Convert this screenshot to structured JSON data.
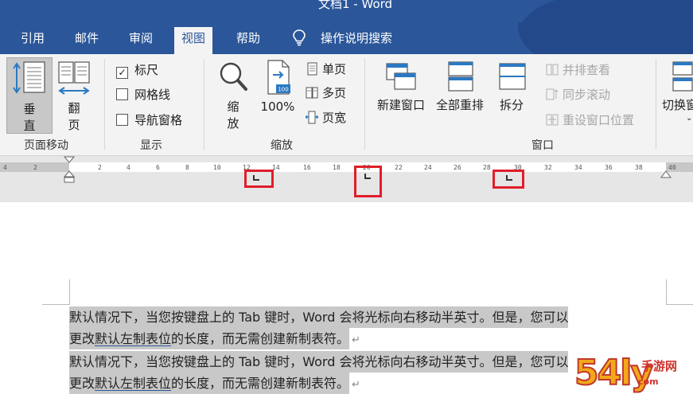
{
  "window": {
    "title": "文档1  -  Word"
  },
  "tabs": [
    {
      "label": "引用"
    },
    {
      "label": "邮件"
    },
    {
      "label": "审阅"
    },
    {
      "label": "视图",
      "active": true
    },
    {
      "label": "帮助"
    }
  ],
  "tell_me": {
    "label": "操作说明搜索",
    "icon": "lightbulb-icon"
  },
  "ribbon": {
    "page_movement": {
      "group_label": "页面移动",
      "vertical": {
        "line1": "垂",
        "line2": "直",
        "selected": true
      },
      "side_to_side": {
        "line1": "翻",
        "line2": "页"
      }
    },
    "show": {
      "group_label": "显示",
      "ruler": {
        "label": "标尺",
        "checked": true
      },
      "gridlines": {
        "label": "网格线",
        "checked": false
      },
      "nav_pane": {
        "label": "导航窗格",
        "checked": false
      }
    },
    "zoom": {
      "group_label": "缩放",
      "zoom_btn": {
        "line1": "缩",
        "line2": "放"
      },
      "hundred": {
        "label": "100%",
        "badge": "100"
      },
      "one_page": {
        "label": "单页"
      },
      "multi_page": {
        "label": "多页"
      },
      "page_width": {
        "label": "页宽"
      }
    },
    "window": {
      "group_label": "窗口",
      "new_window": {
        "label": "新建窗口"
      },
      "arrange_all": {
        "label": "全部重排"
      },
      "split": {
        "label": "拆分"
      },
      "side_by_side": {
        "label": "并排查看"
      },
      "sync_scroll": {
        "label": "同步滚动"
      },
      "reset_pos": {
        "label": "重设窗口位置"
      },
      "switch": {
        "label": "切换窗"
      }
    }
  },
  "ruler": {
    "labels": [
      "4",
      "2",
      "2",
      "4",
      "6",
      "8",
      "10",
      "12",
      "14",
      "16",
      "18",
      "20",
      "22",
      "24",
      "26",
      "28",
      "30",
      "32",
      "34",
      "36",
      "38",
      "40"
    ]
  },
  "document": {
    "paragraphs": [
      {
        "line1": "默认情况下，当您按键盘上的 Tab 键时，Word 会将光标向右移动半英寸。但是，您可以",
        "line2_pre": "更改",
        "line2_link": "默认左制表位",
        "line2_post": "的长度，而无需创建新制表符。",
        "mark": "↵"
      },
      {
        "line1": "默认情况下，当您按键盘上的 Tab 键时，Word 会将光标向右移动半英寸。但是，您可以",
        "line2_pre": "更改",
        "line2_link": "默认左制表位",
        "line2_post": "的长度，而无需创建新制表符。",
        "mark": "↵"
      }
    ]
  },
  "watermark": {
    "number": "54ly",
    "cn": "手游网",
    "domain": "com"
  },
  "colors": {
    "accent": "#2b579a",
    "highlight_box": "#e01e2b",
    "selection": "#c8c8c8"
  }
}
